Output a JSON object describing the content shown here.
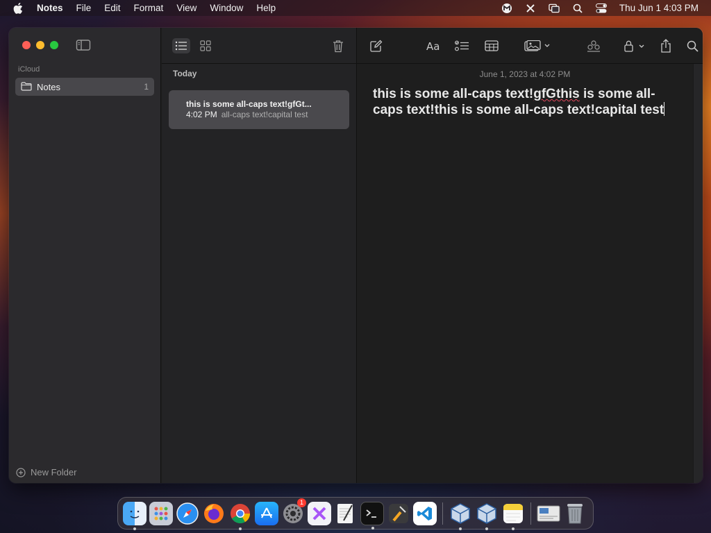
{
  "menubar": {
    "app_name": "Notes",
    "items": [
      "File",
      "Edit",
      "Format",
      "View",
      "Window",
      "Help"
    ],
    "clock": "Thu Jun 1  4:03 PM"
  },
  "sidebar": {
    "section": "iCloud",
    "folder": {
      "label": "Notes",
      "count": "1"
    },
    "new_folder": "New Folder"
  },
  "notes_list": {
    "day_header": "Today",
    "note": {
      "title": "this is some all-caps text!gfGt...",
      "time": "4:02 PM",
      "preview": "all-caps text!capital test"
    }
  },
  "editor": {
    "date": "June 1, 2023 at 4:02 PM",
    "body_part1": "this is some all-caps text!",
    "body_spell": "gfGthis",
    "body_part2": " is some all-caps text!this is some all-caps text!capital test"
  },
  "dock": {
    "items": [
      "finder-icon",
      "launchpad-icon",
      "safari-icon",
      "firefox-icon",
      "chrome-icon",
      "app-store-icon",
      "system-settings-icon",
      "xcode-icon",
      "textedit-icon",
      "terminal-icon",
      "instruments-icon",
      "vscode-icon",
      "virtualbox-icon",
      "virtualbox-icon",
      "notes-icon",
      "preview-icon",
      "trash-icon"
    ],
    "settings_badge": "1"
  },
  "colors": {
    "accent_red": "#fe5f57",
    "accent_yellow": "#febc2e",
    "accent_green": "#28c840",
    "spellcheck": "#e0455a"
  }
}
